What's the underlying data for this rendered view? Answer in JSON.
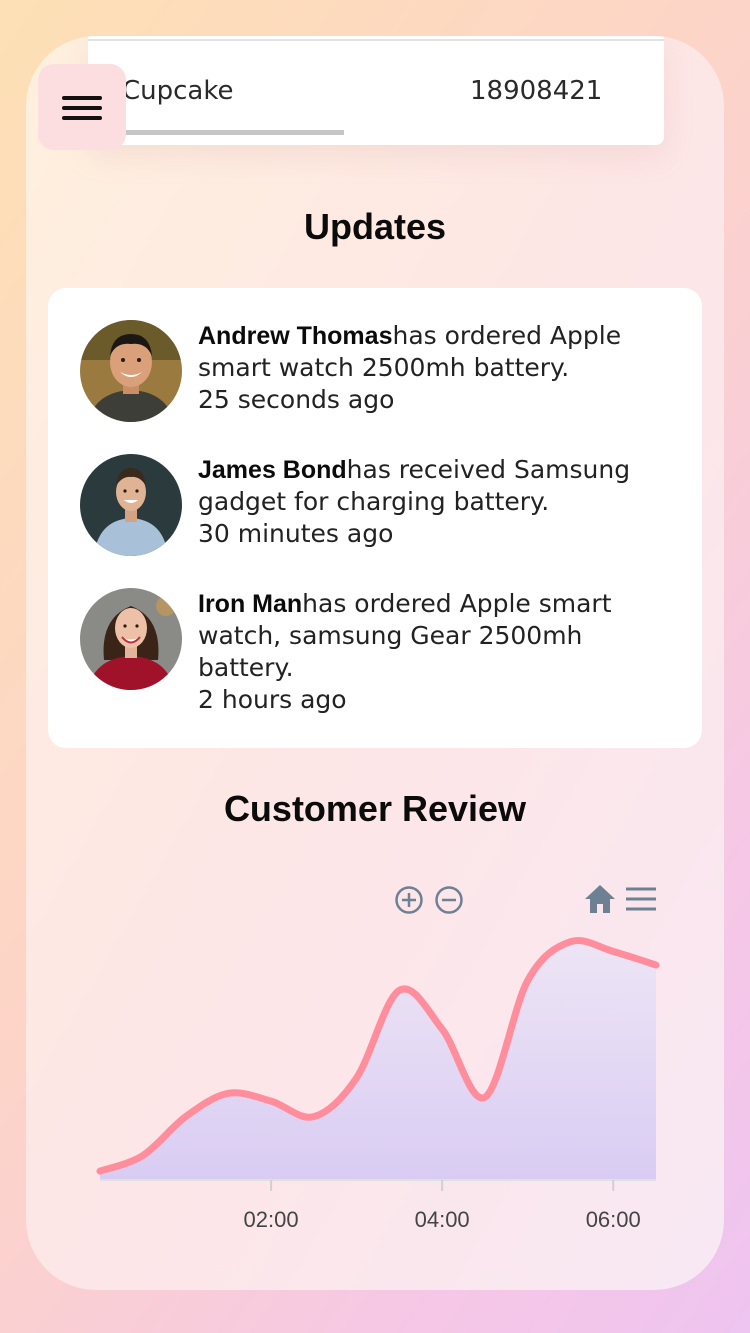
{
  "table": {
    "row": {
      "name": "Cupcake",
      "value": "18908421"
    }
  },
  "menu": {
    "icon": "hamburger-menu-icon"
  },
  "updates": {
    "title": "Updates",
    "items": [
      {
        "name": "Andrew Thomas",
        "action": "has ordered Apple smart watch 2500mh battery.",
        "time": "25 seconds ago",
        "avatar": "man-smiling-avatar"
      },
      {
        "name": "James Bond",
        "action": "has received Samsung gadget for charging battery.",
        "time": "30 minutes ago",
        "avatar": "man-blue-shirt-avatar"
      },
      {
        "name": "Iron Man",
        "action": "has ordered Apple smart watch, samsung Gear 2500mh battery.",
        "time": "2 hours ago",
        "avatar": "woman-red-sweater-avatar"
      }
    ]
  },
  "review": {
    "title": "Customer Review",
    "toolbar": [
      "zoom-in-icon",
      "zoom-out-icon",
      "home-icon",
      "menu-icon"
    ]
  },
  "chart_data": {
    "type": "area",
    "x": [
      "00:00",
      "00:30",
      "01:00",
      "01:30",
      "02:00",
      "02:30",
      "03:00",
      "03:30",
      "04:00",
      "04:30",
      "05:00",
      "05:30",
      "06:00",
      "06:30"
    ],
    "x_tick_labels": [
      "02:00",
      "04:00",
      "06:00"
    ],
    "series": [
      {
        "values": [
          2,
          10,
          30,
          42,
          38,
          30,
          50,
          95,
          75,
          40,
          100,
          120,
          115,
          108
        ]
      }
    ],
    "ylim": [
      0,
      125
    ],
    "line_color": "#ff8d9b",
    "fill_colors": [
      "#ece4f6",
      "#d9ccf3"
    ],
    "grid": false
  }
}
